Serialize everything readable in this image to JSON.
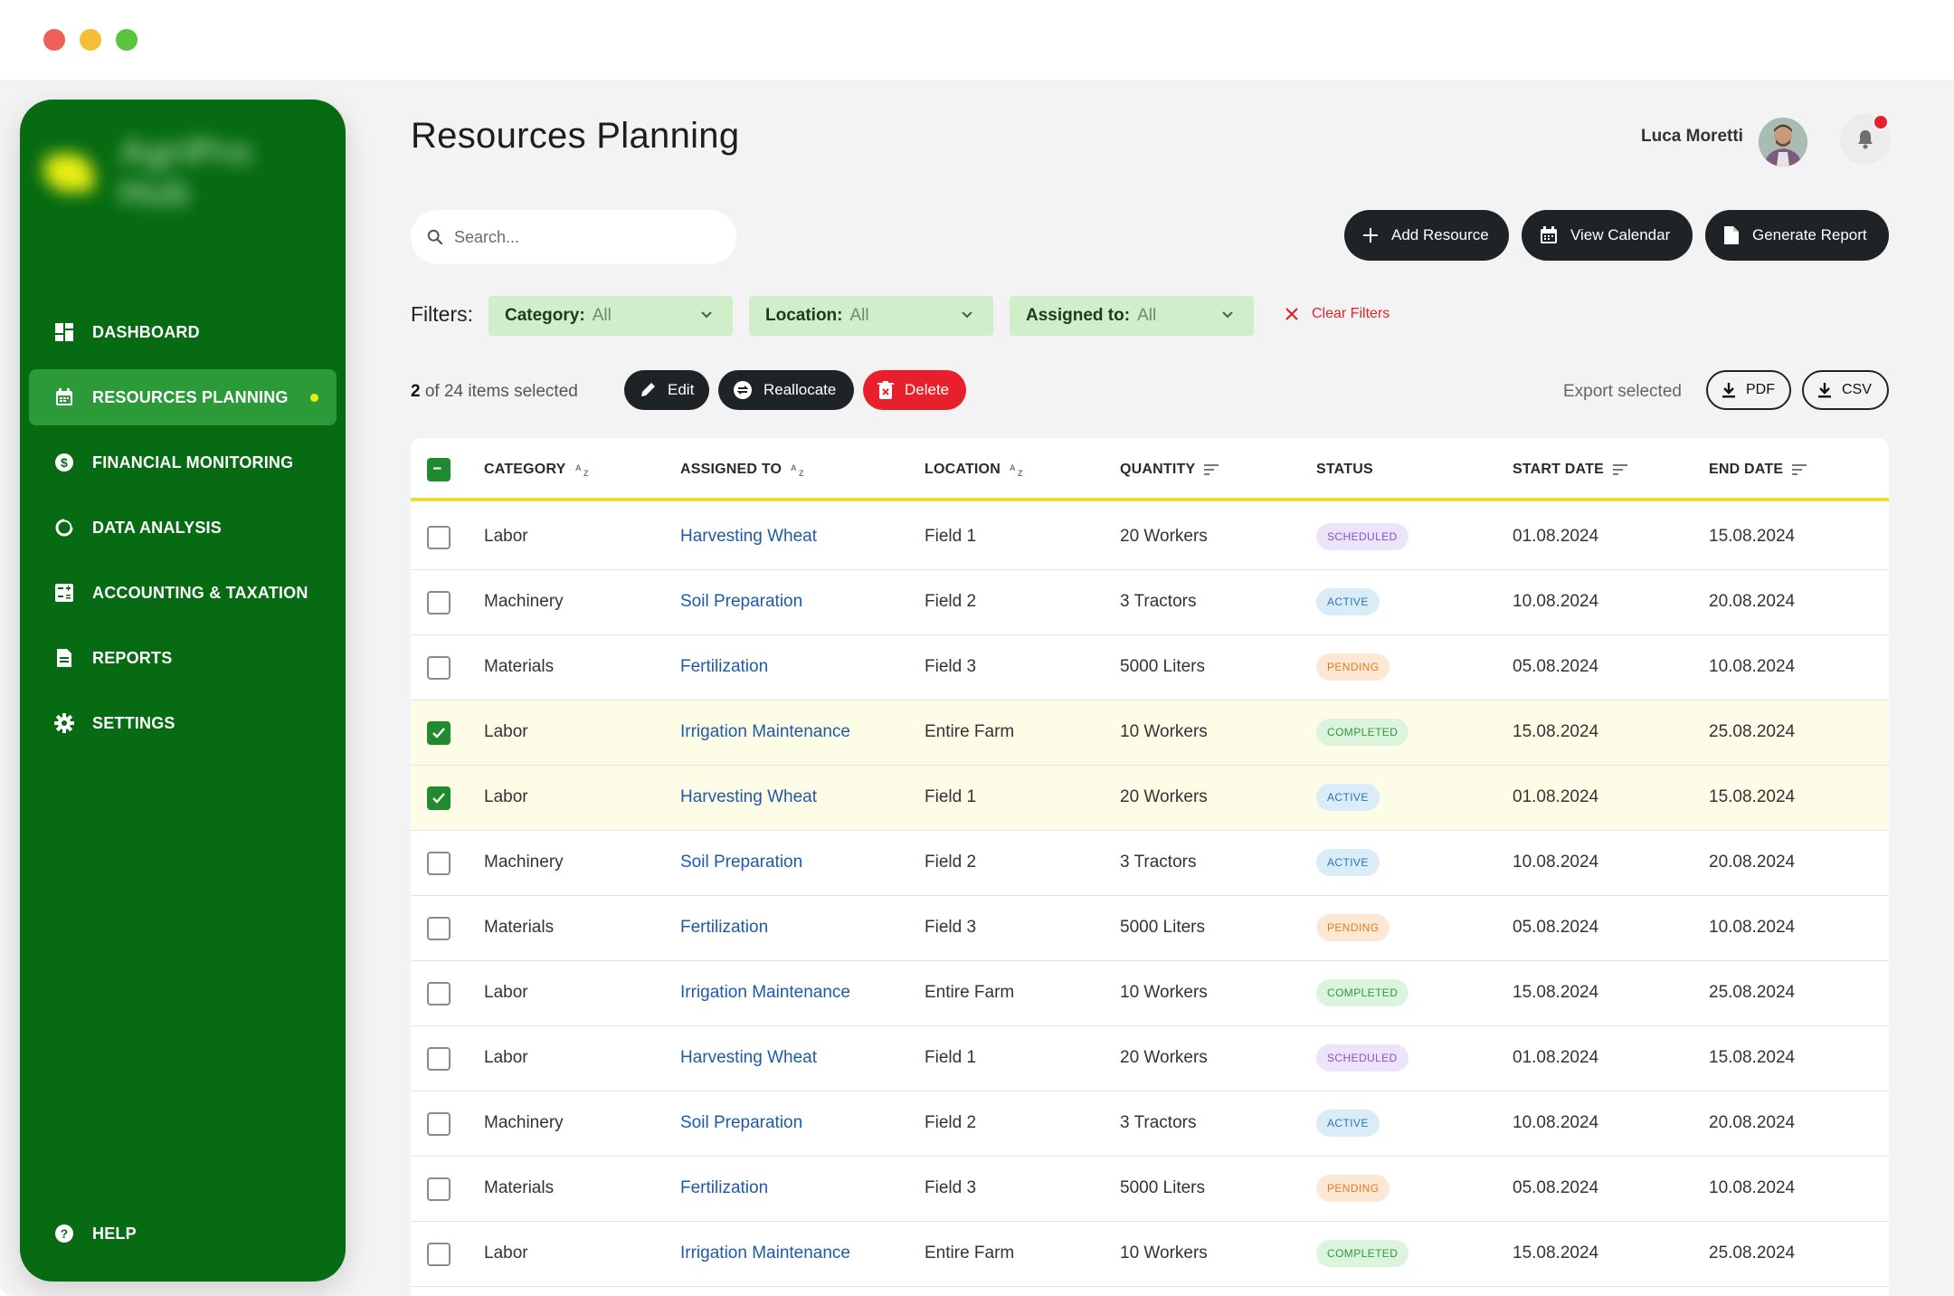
{
  "window": {
    "controls": [
      "close",
      "minimize",
      "maximize"
    ]
  },
  "brand": {
    "name": "AgriPro Hub"
  },
  "sidebar": {
    "items": [
      {
        "label": "DASHBOARD",
        "icon": "dashboard-icon"
      },
      {
        "label": "RESOURCES PLANNING",
        "icon": "calendar-icon",
        "active": true
      },
      {
        "label": "FINANCIAL MONITORING",
        "icon": "dollar-icon"
      },
      {
        "label": "DATA ANALYSIS",
        "icon": "chart-ring-icon"
      },
      {
        "label": "ACCOUNTING & TAXATION",
        "icon": "calculator-icon"
      },
      {
        "label": "REPORTS",
        "icon": "document-icon"
      },
      {
        "label": "SETTINGS",
        "icon": "gear-icon"
      }
    ],
    "help": {
      "label": "HELP",
      "icon": "help-icon"
    }
  },
  "header": {
    "title": "Resources Planning",
    "user_name": "Luca Moretti"
  },
  "search": {
    "placeholder": "Search..."
  },
  "actions": {
    "add_resource": "Add Resource",
    "view_calendar": "View Calendar",
    "generate_report": "Generate Report"
  },
  "filters": {
    "label": "Filters:",
    "category": {
      "key": "Category:",
      "value": "All"
    },
    "location": {
      "key": "Location:",
      "value": "All"
    },
    "assigned": {
      "key": "Assigned to:",
      "value": "All"
    },
    "clear": "Clear Filters"
  },
  "selection": {
    "count": "2",
    "suffix": " of 24 items selected",
    "edit": "Edit",
    "reallocate": "Reallocate",
    "delete": "Delete",
    "export_label": "Export selected",
    "pdf": "PDF",
    "csv": "CSV"
  },
  "table": {
    "columns": [
      "CATEGORY",
      "ASSIGNED TO",
      "LOCATION",
      "QUANTITY",
      "STATUS",
      "START DATE",
      "END DATE"
    ],
    "rows": [
      {
        "category": "Labor",
        "assigned": "Harvesting Wheat",
        "location": "Field 1",
        "quantity": "20 Workers",
        "status": "SCHEDULED",
        "start": "01.08.2024",
        "end": "15.08.2024",
        "checked": false
      },
      {
        "category": "Machinery",
        "assigned": "Soil Preparation",
        "location": "Field 2",
        "quantity": "3 Tractors",
        "status": "ACTIVE",
        "start": "10.08.2024",
        "end": "20.08.2024",
        "checked": false
      },
      {
        "category": "Materials",
        "assigned": "Fertilization",
        "location": "Field 3",
        "quantity": "5000 Liters",
        "status": "PENDING",
        "start": "05.08.2024",
        "end": "10.08.2024",
        "checked": false
      },
      {
        "category": "Labor",
        "assigned": "Irrigation Maintenance",
        "location": "Entire Farm",
        "quantity": "10 Workers",
        "status": "COMPLETED",
        "start": "15.08.2024",
        "end": "25.08.2024",
        "checked": true
      },
      {
        "category": "Labor",
        "assigned": "Harvesting Wheat",
        "location": "Field 1",
        "quantity": "20 Workers",
        "status": "ACTIVE",
        "start": "01.08.2024",
        "end": "15.08.2024",
        "checked": true
      },
      {
        "category": "Machinery",
        "assigned": "Soil Preparation",
        "location": "Field 2",
        "quantity": "3 Tractors",
        "status": "ACTIVE",
        "start": "10.08.2024",
        "end": "20.08.2024",
        "checked": false
      },
      {
        "category": "Materials",
        "assigned": "Fertilization",
        "location": "Field 3",
        "quantity": "5000 Liters",
        "status": "PENDING",
        "start": "05.08.2024",
        "end": "10.08.2024",
        "checked": false
      },
      {
        "category": "Labor",
        "assigned": "Irrigation Maintenance",
        "location": "Entire Farm",
        "quantity": "10 Workers",
        "status": "COMPLETED",
        "start": "15.08.2024",
        "end": "25.08.2024",
        "checked": false
      },
      {
        "category": "Labor",
        "assigned": "Harvesting Wheat",
        "location": "Field 1",
        "quantity": "20 Workers",
        "status": "SCHEDULED",
        "start": "01.08.2024",
        "end": "15.08.2024",
        "checked": false
      },
      {
        "category": "Machinery",
        "assigned": "Soil Preparation",
        "location": "Field 2",
        "quantity": "3 Tractors",
        "status": "ACTIVE",
        "start": "10.08.2024",
        "end": "20.08.2024",
        "checked": false
      },
      {
        "category": "Materials",
        "assigned": "Fertilization",
        "location": "Field 3",
        "quantity": "5000 Liters",
        "status": "PENDING",
        "start": "05.08.2024",
        "end": "10.08.2024",
        "checked": false
      },
      {
        "category": "Labor",
        "assigned": "Irrigation Maintenance",
        "location": "Entire Farm",
        "quantity": "10 Workers",
        "status": "COMPLETED",
        "start": "15.08.2024",
        "end": "25.08.2024",
        "checked": false
      }
    ]
  },
  "colors": {
    "sidebar_bg": "#066b12",
    "sidebar_active": "#2d9a3a",
    "accent_yellow": "#e9ee12",
    "danger": "#e8202b",
    "link": "#1f5aa6",
    "filter_bg": "#cfeec9",
    "selected_row": "#fdfce6"
  }
}
